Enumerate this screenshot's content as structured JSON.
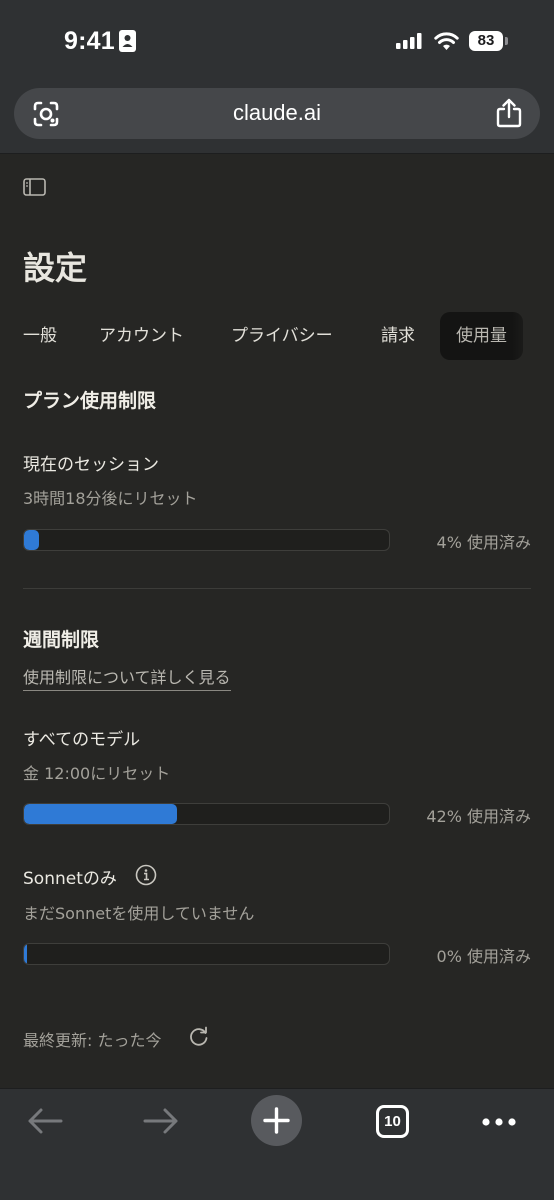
{
  "status_bar": {
    "time": "9:41",
    "battery": "83"
  },
  "browser": {
    "url": "claude.ai",
    "tab_count": "10"
  },
  "page": {
    "title": "設定",
    "tabs": [
      "一般",
      "アカウント",
      "プライバシー",
      "請求",
      "使用量"
    ],
    "active_tab": "使用量"
  },
  "plan_limits": {
    "heading": "プラン使用制限",
    "current_session": {
      "label": "現在のセッション",
      "reset": "3時間18分後にリセット",
      "percent": 4,
      "percent_label": "4% 使用済み"
    }
  },
  "weekly_limits": {
    "heading": "週間制限",
    "learn_more": "使用制限について詳しく見る",
    "all_models": {
      "label": "すべてのモデル",
      "reset": "金 12:00にリセット",
      "percent": 42,
      "percent_label": "42% 使用済み"
    },
    "sonnet": {
      "label": "Sonnetのみ",
      "status": "まだSonnetを使用していません",
      "percent": 0,
      "percent_label": "0% 使用済み"
    }
  },
  "footer": {
    "last_updated": "最終更新: たった今"
  },
  "colors": {
    "accent_bar": "#2f7ad6",
    "background": "#262624",
    "chrome": "#2f3133"
  },
  "icons": {
    "lens": "camera-lens-icon",
    "share": "share-icon",
    "sidebar": "sidebar-toggle-icon",
    "info": "info-icon",
    "refresh": "refresh-icon",
    "back": "back-arrow-icon",
    "forward": "forward-arrow-icon",
    "new_tab": "plus-icon",
    "more": "more-dots-icon"
  }
}
